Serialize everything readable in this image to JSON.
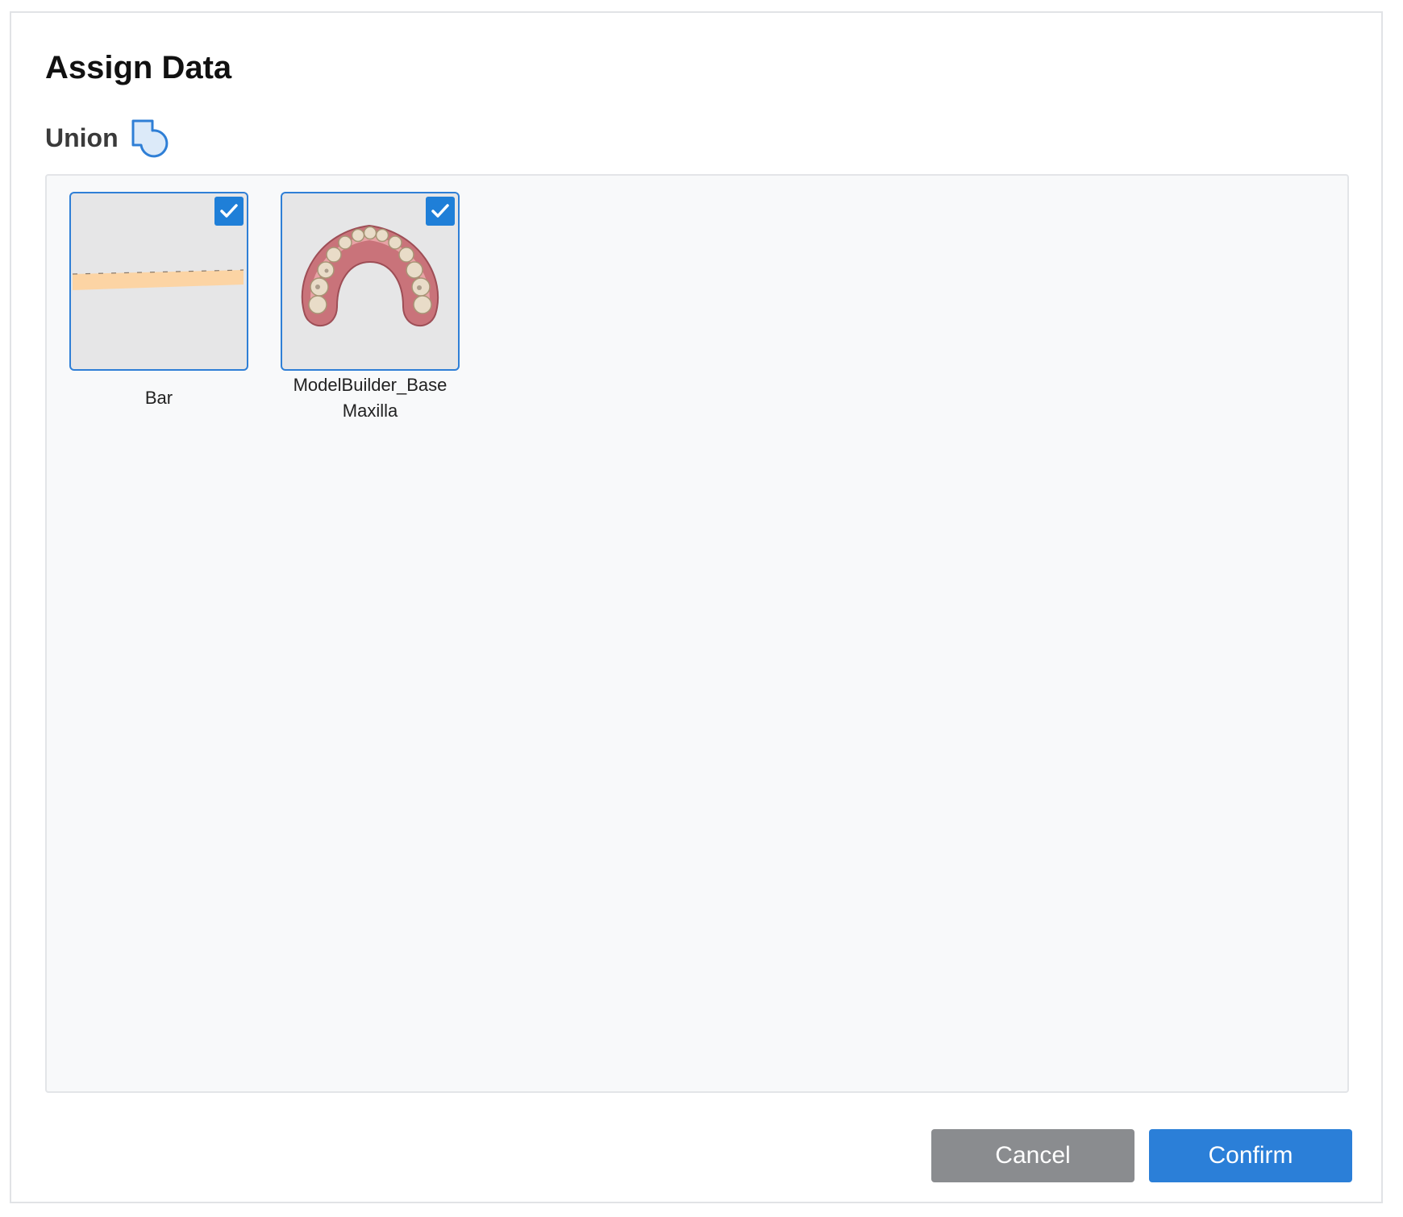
{
  "dialog": {
    "title": "Assign Data"
  },
  "operation": {
    "label": "Union",
    "icon": "union-icon"
  },
  "items": [
    {
      "label_lines": [
        "Bar"
      ],
      "checked": true,
      "thumbnail_icon": "bar-preview"
    },
    {
      "label_lines": [
        "ModelBuilder_Base",
        "Maxilla"
      ],
      "checked": true,
      "thumbnail_icon": "maxilla-model-preview"
    }
  ],
  "buttons": {
    "cancel_label": "Cancel",
    "confirm_label": "Confirm"
  },
  "colors": {
    "accent": "#2b7fd8",
    "checkbox": "#1f7fd8",
    "cancel": "#8a8c8f",
    "panel_background": "#f8f9fa",
    "bar_fill": "#fcd4a4"
  }
}
